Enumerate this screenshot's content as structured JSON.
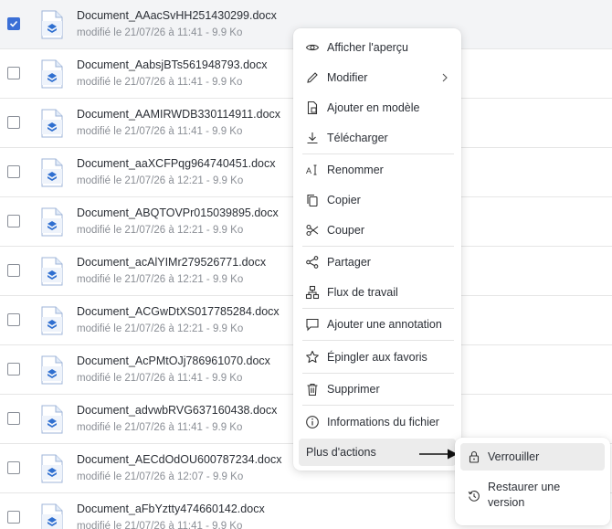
{
  "files": [
    {
      "name": "Document_AAacSvHH251430299.docx",
      "meta": "modifié le 21/07/26 à 11:41 - 9.9 Ko",
      "checked": true
    },
    {
      "name": "Document_AabsjBTs561948793.docx",
      "meta": "modifié le 21/07/26 à 11:41 - 9.9 Ko",
      "checked": false
    },
    {
      "name": "Document_AAMIRWDB330114911.docx",
      "meta": "modifié le 21/07/26 à 11:41 - 9.9 Ko",
      "checked": false
    },
    {
      "name": "Document_aaXCFPqg964740451.docx",
      "meta": "modifié le 21/07/26 à 12:21 - 9.9 Ko",
      "checked": false
    },
    {
      "name": "Document_ABQTOVPr015039895.docx",
      "meta": "modifié le 21/07/26 à 12:21 - 9.9 Ko",
      "checked": false
    },
    {
      "name": "Document_acAlYIMr279526771.docx",
      "meta": "modifié le 21/07/26 à 12:21 - 9.9 Ko",
      "checked": false
    },
    {
      "name": "Document_ACGwDtXS017785284.docx",
      "meta": "modifié le 21/07/26 à 12:21 - 9.9 Ko",
      "checked": false
    },
    {
      "name": "Document_AcPMtOJj786961070.docx",
      "meta": "modifié le 21/07/26 à 11:41 - 9.9 Ko",
      "checked": false
    },
    {
      "name": "Document_advwbRVG637160438.docx",
      "meta": "modifié le 21/07/26 à 11:41 - 9.9 Ko",
      "checked": false
    },
    {
      "name": "Document_AECdOdOU600787234.docx",
      "meta": "modifié le 21/07/26 à 12:07 - 9.9 Ko",
      "checked": false
    },
    {
      "name": "Document_aFbYztty474660142.docx",
      "meta": "modifié le 21/07/26 à 11:41 - 9.9 Ko",
      "checked": false
    }
  ],
  "menu": {
    "items": [
      {
        "label": "Afficher l'aperçu",
        "icon": "eye-icon"
      },
      {
        "label": "Modifier",
        "icon": "pencil-icon"
      },
      {
        "label": "Ajouter en modèle",
        "icon": "template-icon"
      },
      {
        "label": "Télécharger",
        "icon": "download-icon"
      },
      {
        "label": "Renommer",
        "icon": "rename-icon"
      },
      {
        "label": "Copier",
        "icon": "copy-icon"
      },
      {
        "label": "Couper",
        "icon": "scissors-icon"
      },
      {
        "label": "Partager",
        "icon": "share-icon"
      },
      {
        "label": "Flux de travail",
        "icon": "workflow-icon"
      },
      {
        "label": "Ajouter une annotation",
        "icon": "comment-icon"
      },
      {
        "label": "Épingler aux favoris",
        "icon": "star-icon"
      },
      {
        "label": "Supprimer",
        "icon": "trash-icon"
      },
      {
        "label": "Informations du fichier",
        "icon": "info-icon"
      }
    ],
    "more_label": "Plus d'actions"
  },
  "submenu": {
    "lock_label": "Verrouiller",
    "restore_label_line1": "Restaurer une",
    "restore_label_line2": "version"
  },
  "colors": {
    "accent": "#3b6fd6",
    "file_icon": "#2f6fd0"
  }
}
